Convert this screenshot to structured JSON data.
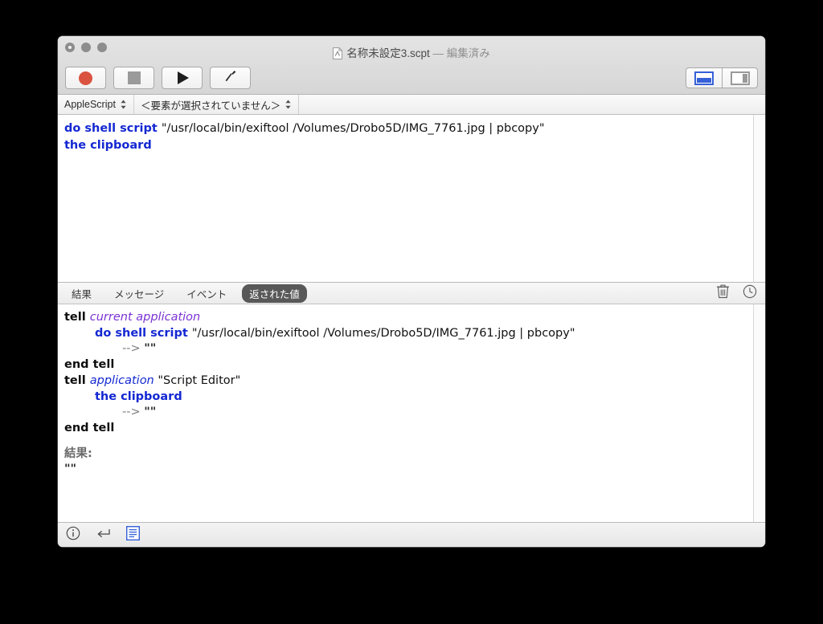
{
  "window": {
    "title_name": "名称未設定3.scpt",
    "title_dash": " — ",
    "title_state": "編集済み",
    "doc_icon": "applescript-document-icon",
    "traffic": [
      {
        "name": "close-button",
        "label": "閉じる"
      },
      {
        "name": "minimize-button",
        "label": "しまう"
      },
      {
        "name": "zoom-button",
        "label": "拡大"
      }
    ]
  },
  "toolbar": {
    "record_label": "記録",
    "record_icon": "record-circle-icon",
    "stop_label": "停止",
    "stop_icon": "stop-square-icon",
    "run_label": "実行",
    "run_icon": "run-triangle-icon",
    "compile_label": "コンパイル",
    "compile_icon": "hammer-icon",
    "bottom_pane_label": "下部分割表示",
    "bottom_pane_icon": "pane-bottom-icon",
    "side_pane_label": "横分割表示",
    "side_pane_icon": "pane-right-icon",
    "accent_color": "#3560d8",
    "record_color": "#d9533f"
  },
  "navbar": {
    "language": "AppleScript",
    "element": "＜要素が選択されていません＞",
    "stepper_up": "▲",
    "stepper_down": "▼"
  },
  "editor": {
    "lines": [
      {
        "segments": [
          {
            "kind": "kw",
            "text": "do shell script "
          },
          {
            "kind": "str",
            "text": "\"/usr/local/bin/exiftool /Volumes/Drobo5D/IMG_7761.jpg | pbcopy\""
          }
        ]
      },
      {
        "segments": [
          {
            "kind": "kw",
            "text": "the clipboard"
          }
        ]
      }
    ],
    "line1_keyword": "do shell script ",
    "line1_string": "\"/usr/local/bin/exiftool /Volumes/Drobo5D/IMG_7761.jpg | pbcopy\"",
    "line2_keyword": "the clipboard"
  },
  "tabs": {
    "items": [
      {
        "label": "結果",
        "selected": false
      },
      {
        "label": "メッセージ",
        "selected": false
      },
      {
        "label": "イベント",
        "selected": false
      },
      {
        "label": "返された値",
        "selected": true
      }
    ],
    "tab_result": "結果",
    "tab_messages": "メッセージ",
    "tab_events": "イベント",
    "tab_replies": "返された値",
    "trash_label": "消去",
    "trash_icon": "trash-icon",
    "clock_label": "履歴",
    "clock_icon": "clock-icon"
  },
  "log": {
    "l1_tell": "tell ",
    "l1_class": "current application",
    "l2_kw": "do shell script ",
    "l2_str": "\"/usr/local/bin/exiftool /Volumes/Drobo5D/IMG_7761.jpg | pbcopy\"",
    "l3_arrow": "--> ",
    "l3_val": "\"\"",
    "l4_end": "end tell",
    "l5_tell": "tell ",
    "l5_app": "application",
    "l5_name": " \"Script Editor\"",
    "l6_kw": "the clipboard",
    "l7_arrow": "--> ",
    "l7_val": "\"\"",
    "l8_end": "end tell",
    "result_label": "結果:",
    "result_value": "\"\""
  },
  "statusbar": {
    "info_label": "説明",
    "info_icon": "info-circle-icon",
    "wrap_label": "改行",
    "wrap_icon": "return-arrow-icon",
    "list_label": "行の表示",
    "list_icon": "lines-list-icon",
    "list_accent": "#3560d8"
  }
}
